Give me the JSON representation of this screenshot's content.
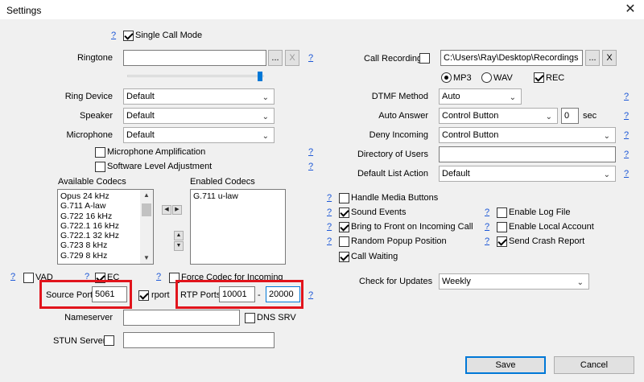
{
  "window": {
    "title": "Settings",
    "close_glyph": "✕"
  },
  "help_glyph": "?",
  "single_call_mode": {
    "label": "Single Call Mode",
    "checked": true
  },
  "ringtone": {
    "label": "Ringtone",
    "value": "",
    "browse": "...",
    "clear": "X",
    "volume_level": 1.0
  },
  "ring_device": {
    "label": "Ring Device",
    "value": "Default"
  },
  "speaker": {
    "label": "Speaker",
    "value": "Default"
  },
  "microphone": {
    "label": "Microphone",
    "value": "Default"
  },
  "mic_amplification": {
    "label": "Microphone Amplification",
    "checked": false
  },
  "software_level": {
    "label": "Software Level Adjustment",
    "checked": false
  },
  "codecs": {
    "available_label": "Available Codecs",
    "enabled_label": "Enabled Codecs",
    "available": [
      "Opus 24 kHz",
      "G.711 A-law",
      "G.722 16 kHz",
      "G.722.1 16 kHz",
      "G.722.1 32 kHz",
      "G.723 8 kHz",
      "G.729 8 kHz"
    ],
    "enabled": [
      "G.711 u-law"
    ]
  },
  "vad": {
    "label": "VAD",
    "checked": false
  },
  "ec": {
    "label": "EC",
    "checked": true
  },
  "force_codec": {
    "label": "Force Codec for Incoming",
    "checked": false
  },
  "source_port": {
    "label": "Source Port",
    "value": "5061"
  },
  "rport": {
    "label": "rport",
    "checked": true
  },
  "rtp_ports": {
    "label": "RTP Ports",
    "from": "10001",
    "sep": "-",
    "to": "20000"
  },
  "nameserver": {
    "label": "Nameserver",
    "value": ""
  },
  "dns_srv": {
    "label": "DNS SRV",
    "checked": false
  },
  "stun_server": {
    "label": "STUN Server",
    "value": "",
    "checked": false
  },
  "call_recording": {
    "label": "Call Recording",
    "checked": false,
    "path": "C:\\Users\\Ray\\Desktop\\Recordings",
    "browse": "...",
    "clear": "X",
    "mp3_label": "MP3",
    "wav_label": "WAV",
    "format": "MP3",
    "rec_label": "REC",
    "rec_checked": true
  },
  "dtmf_method": {
    "label": "DTMF Method",
    "value": "Auto"
  },
  "auto_answer": {
    "label": "Auto Answer",
    "value": "Control Button",
    "seconds": "0",
    "unit": "sec"
  },
  "deny_incoming": {
    "label": "Deny Incoming",
    "value": "Control Button"
  },
  "directory_of_users": {
    "label": "Directory of Users",
    "value": ""
  },
  "default_list_action": {
    "label": "Default List Action",
    "value": "Default"
  },
  "options": {
    "handle_media_buttons": {
      "label": "Handle Media Buttons",
      "checked": false
    },
    "sound_events": {
      "label": "Sound Events",
      "checked": true
    },
    "bring_to_front": {
      "label": "Bring to Front on Incoming Call",
      "checked": true
    },
    "random_popup": {
      "label": "Random Popup Position",
      "checked": false
    },
    "call_waiting": {
      "label": "Call Waiting",
      "checked": true
    },
    "enable_log_file": {
      "label": "Enable Log File",
      "checked": false
    },
    "enable_local_account": {
      "label": "Enable Local Account",
      "checked": false
    },
    "send_crash_report": {
      "label": "Send Crash Report",
      "checked": true
    }
  },
  "check_for_updates": {
    "label": "Check for Updates",
    "value": "Weekly"
  },
  "buttons": {
    "save": "Save",
    "cancel": "Cancel"
  },
  "colors": {
    "accent": "#0078d7",
    "highlight_box": "#e1141c",
    "help_link": "#1a56d6"
  }
}
